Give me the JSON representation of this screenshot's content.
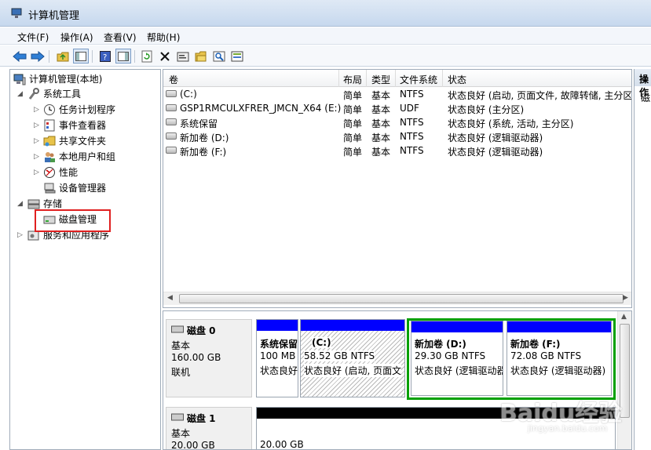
{
  "window": {
    "title": "计算机管理"
  },
  "menu": [
    "文件(F)",
    "操作(A)",
    "查看(V)",
    "帮助(H)"
  ],
  "tree": {
    "root": "计算机管理(本地)",
    "system_tools": "系统工具",
    "items": [
      "任务计划程序",
      "事件查看器",
      "共享文件夹",
      "本地用户和组",
      "性能",
      "设备管理器"
    ],
    "storage": "存储",
    "disk_management": "磁盘管理",
    "services": "服务和应用程序"
  },
  "volume_list": {
    "columns": [
      "卷",
      "布局",
      "类型",
      "文件系统",
      "状态"
    ],
    "rows": [
      {
        "volume": "(C:)",
        "layout": "简单",
        "type": "基本",
        "fs": "NTFS",
        "status": "状态良好 (启动, 页面文件, 故障转储, 主分区"
      },
      {
        "volume": "GSP1RMCULXFRER_JMCN_X64 (E:)",
        "layout": "简单",
        "type": "基本",
        "fs": "UDF",
        "status": "状态良好 (主分区)"
      },
      {
        "volume": "系统保留",
        "layout": "简单",
        "type": "基本",
        "fs": "NTFS",
        "status": "状态良好 (系统, 活动, 主分区)"
      },
      {
        "volume": "新加卷 (D:)",
        "layout": "简单",
        "type": "基本",
        "fs": "NTFS",
        "status": "状态良好 (逻辑驱动器)"
      },
      {
        "volume": "新加卷 (F:)",
        "layout": "简单",
        "type": "基本",
        "fs": "NTFS",
        "status": "状态良好 (逻辑驱动器)"
      }
    ]
  },
  "disks": [
    {
      "name": "磁盘 0",
      "kind": "基本",
      "size": "160.00 GB",
      "state": "联机",
      "partitions": [
        {
          "name": "系统保留",
          "size": "100 MB",
          "status": "状态良好"
        },
        {
          "name": "(C:)",
          "size": "58.52 GB NTFS",
          "status": "状态良好 (启动, 页面文"
        },
        {
          "name": "新加卷  (D:)",
          "size": "29.30 GB NTFS",
          "status": "状态良好 (逻辑驱动器"
        },
        {
          "name": "新加卷  (F:)",
          "size": "72.08 GB NTFS",
          "status": "状态良好 (逻辑驱动器)"
        }
      ]
    },
    {
      "name": "磁盘 1",
      "kind": "基本",
      "size": "20.00 GB",
      "partitions": [
        {
          "size": "20.00 GB"
        }
      ]
    }
  ],
  "actions": {
    "header": "操作",
    "item": "磁"
  },
  "watermark": {
    "logo": "Baidu经验",
    "url": "jingyan.baidu.com"
  },
  "colors": {
    "primary": "#0000ff",
    "extended": "#00a000",
    "unallocated": "#000000",
    "highlight": "#e02020"
  }
}
